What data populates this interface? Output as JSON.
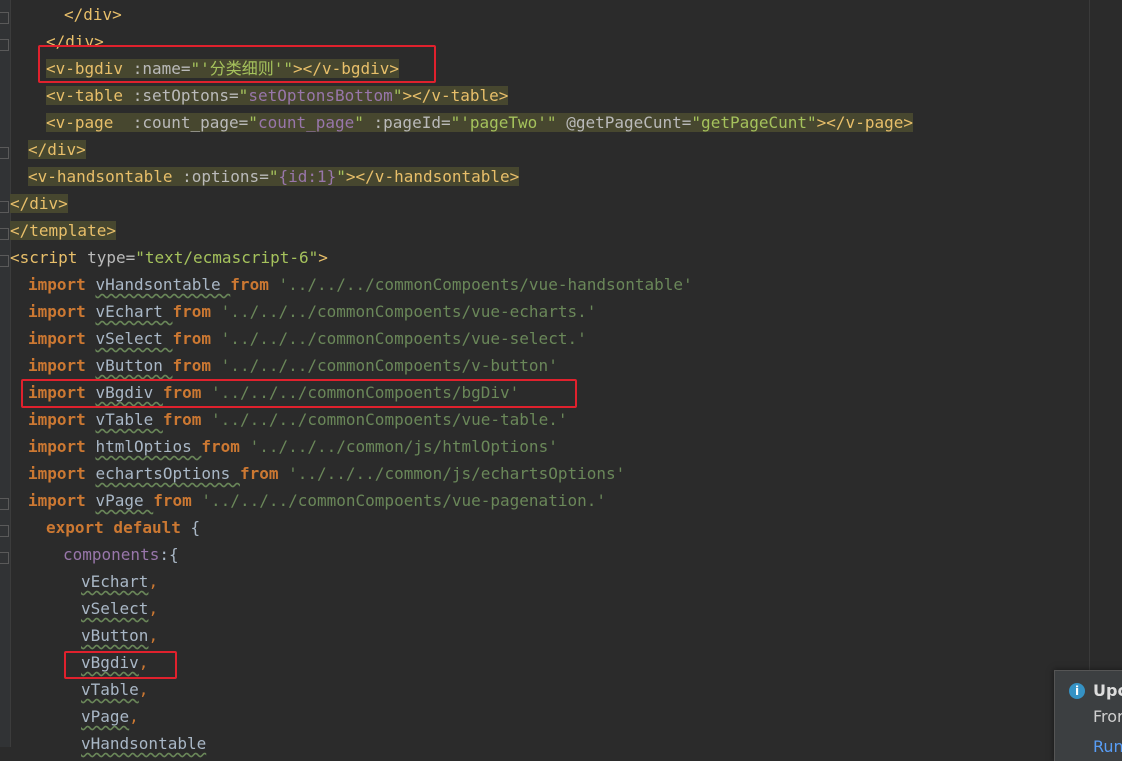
{
  "editor": {
    "lines": [
      {
        "indent": 64,
        "hl": false,
        "parts": [
          {
            "c": "tag",
            "t": "</div>"
          }
        ]
      },
      {
        "indent": 46,
        "hl": false,
        "parts": [
          {
            "c": "tag",
            "t": "</div>"
          }
        ]
      },
      {
        "indent": 46,
        "hl": true,
        "parts": [
          {
            "c": "tag",
            "t": "<v-bgdiv "
          },
          {
            "c": "attr",
            "t": ":name="
          },
          {
            "c": "val",
            "t": "\"'分类细则'\""
          },
          {
            "c": "tag",
            "t": "></v-bgdiv>"
          }
        ]
      },
      {
        "indent": 46,
        "hl": true,
        "parts": [
          {
            "c": "tag",
            "t": "<v-table "
          },
          {
            "c": "attr",
            "t": ":setOptons="
          },
          {
            "c": "val",
            "t": "\""
          },
          {
            "c": "bind",
            "t": "setOptonsBottom"
          },
          {
            "c": "val",
            "t": "\""
          },
          {
            "c": "tag",
            "t": "></v-table>"
          }
        ]
      },
      {
        "indent": 46,
        "hl": true,
        "parts": [
          {
            "c": "tag",
            "t": "<v-page  "
          },
          {
            "c": "attr",
            "t": ":count_page="
          },
          {
            "c": "val",
            "t": "\""
          },
          {
            "c": "bind",
            "t": "count_page"
          },
          {
            "c": "val",
            "t": "\" "
          },
          {
            "c": "attr",
            "t": ":pageId="
          },
          {
            "c": "val",
            "t": "\"'pageTwo'\" "
          },
          {
            "c": "attr",
            "t": "@getPageCunt="
          },
          {
            "c": "val",
            "t": "\"getPageCunt\""
          },
          {
            "c": "tag",
            "t": "></v-page>"
          }
        ]
      },
      {
        "indent": 28,
        "hl": true,
        "parts": [
          {
            "c": "tag",
            "t": "</div>"
          }
        ]
      },
      {
        "indent": 28,
        "hl": true,
        "parts": [
          {
            "c": "tag",
            "t": "<v-handsontable "
          },
          {
            "c": "attr",
            "t": ":options="
          },
          {
            "c": "val",
            "t": "\""
          },
          {
            "c": "bind",
            "t": "{id:1}"
          },
          {
            "c": "val",
            "t": "\""
          },
          {
            "c": "tag",
            "t": "></v-handsontable>"
          }
        ]
      },
      {
        "indent": 10,
        "hl": true,
        "parts": [
          {
            "c": "tag",
            "t": "</div>"
          }
        ]
      },
      {
        "indent": 10,
        "hl": true,
        "parts": [
          {
            "c": "tag",
            "t": "</template>"
          }
        ]
      },
      {
        "indent": 10,
        "hl": false,
        "parts": [
          {
            "c": "tag",
            "t": "<script "
          },
          {
            "c": "attr",
            "t": "type="
          },
          {
            "c": "val",
            "t": "\"text/ecmascript-6\""
          },
          {
            "c": "tag",
            "t": ">"
          }
        ]
      },
      {
        "indent": 28,
        "hl": false,
        "parts": [
          {
            "c": "kw",
            "t": "import "
          },
          {
            "c": "id",
            "t": "vHandsontable "
          },
          {
            "c": "kw",
            "t": "from "
          },
          {
            "c": "str",
            "t": "'../../../commonCompoents/vue-handsontable'"
          }
        ]
      },
      {
        "indent": 28,
        "hl": false,
        "parts": [
          {
            "c": "kw",
            "t": "import "
          },
          {
            "c": "id",
            "t": "vEchart "
          },
          {
            "c": "kw",
            "t": "from "
          },
          {
            "c": "str",
            "t": "'../../../commonCompoents/vue-echarts.'"
          }
        ]
      },
      {
        "indent": 28,
        "hl": false,
        "parts": [
          {
            "c": "kw",
            "t": "import "
          },
          {
            "c": "id",
            "t": "vSelect "
          },
          {
            "c": "kw",
            "t": "from "
          },
          {
            "c": "str",
            "t": "'../../../commonCompoents/vue-select.'"
          }
        ]
      },
      {
        "indent": 28,
        "hl": false,
        "parts": [
          {
            "c": "kw",
            "t": "import "
          },
          {
            "c": "id",
            "t": "vButton "
          },
          {
            "c": "kw",
            "t": "from "
          },
          {
            "c": "str",
            "t": "'../../../commonCompoents/v-button'"
          }
        ]
      },
      {
        "indent": 28,
        "hl": false,
        "parts": [
          {
            "c": "kw",
            "t": "import "
          },
          {
            "c": "id",
            "t": "vBgdiv "
          },
          {
            "c": "kw",
            "t": "from "
          },
          {
            "c": "str",
            "t": "'../../../commonCompoents/bgDiv'"
          }
        ]
      },
      {
        "indent": 28,
        "hl": false,
        "parts": [
          {
            "c": "kw",
            "t": "import "
          },
          {
            "c": "id",
            "t": "vTable "
          },
          {
            "c": "kw",
            "t": "from "
          },
          {
            "c": "str",
            "t": "'../../../commonCompoents/vue-table.'"
          }
        ]
      },
      {
        "indent": 28,
        "hl": false,
        "parts": [
          {
            "c": "kw",
            "t": "import "
          },
          {
            "c": "id",
            "t": "htmlOptios "
          },
          {
            "c": "kw",
            "t": "from "
          },
          {
            "c": "str",
            "t": "'../../../common/js/htmlOptions'"
          }
        ]
      },
      {
        "indent": 28,
        "hl": false,
        "parts": [
          {
            "c": "kw",
            "t": "import "
          },
          {
            "c": "id",
            "t": "echartsOptions "
          },
          {
            "c": "kw",
            "t": "from "
          },
          {
            "c": "str",
            "t": "'../../../common/js/echartsOptions'"
          }
        ]
      },
      {
        "indent": 28,
        "hl": false,
        "parts": [
          {
            "c": "kw",
            "t": "import "
          },
          {
            "c": "id",
            "t": "vPage "
          },
          {
            "c": "kw",
            "t": "from "
          },
          {
            "c": "str",
            "t": "'../../../commonCompoents/vue-pagenation.'"
          }
        ]
      },
      {
        "indent": 46,
        "hl": false,
        "parts": [
          {
            "c": "kw",
            "t": "export default "
          },
          {
            "c": "ident",
            "t": "{"
          }
        ]
      },
      {
        "indent": 63,
        "hl": false,
        "parts": [
          {
            "c": "prop",
            "t": "components"
          },
          {
            "c": "ident",
            "t": ":{"
          }
        ]
      },
      {
        "indent": 81,
        "hl": false,
        "parts": [
          {
            "c": "ident",
            "t": "vEchart"
          },
          {
            "c": "punc",
            "t": ","
          }
        ]
      },
      {
        "indent": 81,
        "hl": false,
        "parts": [
          {
            "c": "ident",
            "t": "vSelect"
          },
          {
            "c": "punc",
            "t": ","
          }
        ]
      },
      {
        "indent": 81,
        "hl": false,
        "parts": [
          {
            "c": "ident",
            "t": "vButton"
          },
          {
            "c": "punc",
            "t": ","
          }
        ]
      },
      {
        "indent": 81,
        "hl": false,
        "parts": [
          {
            "c": "ident",
            "t": "vBgdiv"
          },
          {
            "c": "punc",
            "t": ","
          }
        ]
      },
      {
        "indent": 81,
        "hl": false,
        "parts": [
          {
            "c": "ident",
            "t": "vTable"
          },
          {
            "c": "punc",
            "t": ","
          }
        ]
      },
      {
        "indent": 81,
        "hl": false,
        "parts": [
          {
            "c": "ident",
            "t": "vPage"
          },
          {
            "c": "punc",
            "t": ","
          }
        ]
      },
      {
        "indent": 81,
        "hl": false,
        "parts": [
          {
            "c": "ident",
            "t": "vHandsontable"
          }
        ]
      }
    ]
  },
  "notification": {
    "title": "Upc",
    "body": "Fror",
    "link": "Run"
  },
  "colors": {
    "background": "#2b2b2b",
    "highlight": "#47472f",
    "annotation_box": "#e0212d"
  }
}
